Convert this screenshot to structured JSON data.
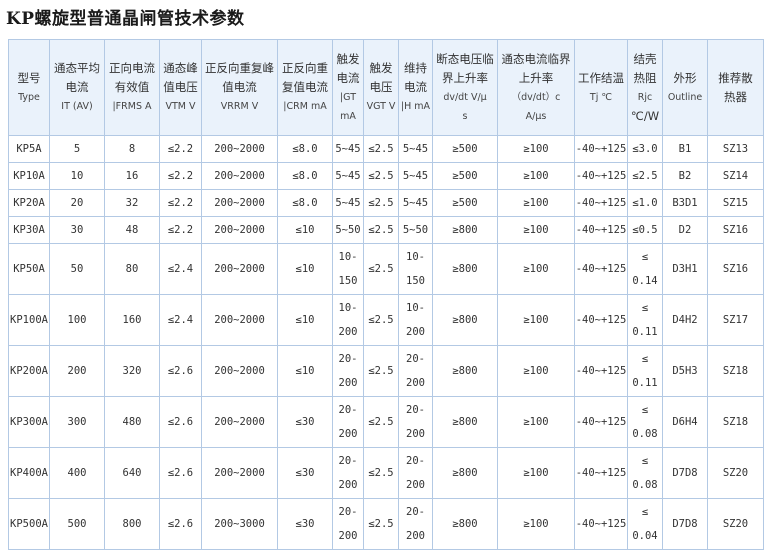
{
  "title": "KP螺旋型普通晶闸管技术参数",
  "headers": [
    [
      "型号",
      "Type"
    ],
    [
      "通态平均",
      "电流",
      "IT (AV)"
    ],
    [
      "正向电流",
      "有效值",
      "|FRMS A"
    ],
    [
      "通态峰",
      "值电压",
      "VTM V"
    ],
    [
      "正反向重复峰",
      "值电流",
      "VRRM V"
    ],
    [
      "正反向重",
      "复值电流",
      "|CRM mA"
    ],
    [
      "触发",
      "电流",
      "|GT",
      "mA"
    ],
    [
      "触发",
      "电压",
      "VGT V"
    ],
    [
      "维持",
      "电流",
      "|H mA"
    ],
    [
      "断态电压临",
      "界上升率",
      "dv/dt V/μ",
      "s"
    ],
    [
      "通态电流临界",
      "上升率",
      "（dv/dt）c",
      "A/μs"
    ],
    [
      "工作结温",
      "Tj ℃"
    ],
    [
      "结壳",
      "热阻",
      "Rjc",
      "℃/W"
    ],
    [
      "外形",
      "Outline"
    ],
    [
      "推荐散",
      "热器"
    ]
  ],
  "rows": [
    {
      "type": "KP5A",
      "it": "5",
      "ifrms": "8",
      "vtm": "≤2.2",
      "vrrm": "200~2000",
      "irrm": "≤8.0",
      "igt": [
        "5~45"
      ],
      "vgt": "≤2.5",
      "ih": [
        "5~45"
      ],
      "dvdt": "≥500",
      "didt": "≥100",
      "tj": "-40~+125",
      "rjc": [
        "≤3.0"
      ],
      "outline": "B1",
      "sink": "SZ13"
    },
    {
      "type": "KP10A",
      "it": "10",
      "ifrms": "16",
      "vtm": "≤2.2",
      "vrrm": "200~2000",
      "irrm": "≤8.0",
      "igt": [
        "5~45"
      ],
      "vgt": "≤2.5",
      "ih": [
        "5~45"
      ],
      "dvdt": "≥500",
      "didt": "≥100",
      "tj": "-40~+125",
      "rjc": [
        "≤2.5"
      ],
      "outline": "B2",
      "sink": "SZ14"
    },
    {
      "type": "KP20A",
      "it": "20",
      "ifrms": "32",
      "vtm": "≤2.2",
      "vrrm": "200~2000",
      "irrm": "≤8.0",
      "igt": [
        "5~45"
      ],
      "vgt": "≤2.5",
      "ih": [
        "5~45"
      ],
      "dvdt": "≥500",
      "didt": "≥100",
      "tj": "-40~+125",
      "rjc": [
        "≤1.0"
      ],
      "outline": "B3D1",
      "sink": "SZ15"
    },
    {
      "type": "KP30A",
      "it": "30",
      "ifrms": "48",
      "vtm": "≤2.2",
      "vrrm": "200~2000",
      "irrm": "≤10",
      "igt": [
        "5~50"
      ],
      "vgt": "≤2.5",
      "ih": [
        "5~50"
      ],
      "dvdt": "≥800",
      "didt": "≥100",
      "tj": "-40~+125",
      "rjc": [
        "≤0.5"
      ],
      "outline": "D2",
      "sink": "SZ16"
    },
    {
      "type": "KP50A",
      "it": "50",
      "ifrms": "80",
      "vtm": "≤2.4",
      "vrrm": "200~2000",
      "irrm": "≤10",
      "igt": [
        "10-",
        "150"
      ],
      "vgt": "≤2.5",
      "ih": [
        "10-",
        "150"
      ],
      "dvdt": "≥800",
      "didt": "≥100",
      "tj": "-40~+125",
      "rjc": [
        "≤",
        "0.14"
      ],
      "outline": "D3H1",
      "sink": "SZ16"
    },
    {
      "type": "KP100A",
      "it": "100",
      "ifrms": "160",
      "vtm": "≤2.4",
      "vrrm": "200~2000",
      "irrm": "≤10",
      "igt": [
        "10-",
        "200"
      ],
      "vgt": "≤2.5",
      "ih": [
        "10-",
        "200"
      ],
      "dvdt": "≥800",
      "didt": "≥100",
      "tj": "-40~+125",
      "rjc": [
        "≤",
        "0.11"
      ],
      "outline": "D4H2",
      "sink": "SZ17"
    },
    {
      "type": "KP200A",
      "it": "200",
      "ifrms": "320",
      "vtm": "≤2.6",
      "vrrm": "200~2000",
      "irrm": "≤10",
      "igt": [
        "20-",
        "200"
      ],
      "vgt": "≤2.5",
      "ih": [
        "20-",
        "200"
      ],
      "dvdt": "≥800",
      "didt": "≥100",
      "tj": "-40~+125",
      "rjc": [
        "≤",
        "0.11"
      ],
      "outline": "D5H3",
      "sink": "SZ18"
    },
    {
      "type": "KP300A",
      "it": "300",
      "ifrms": "480",
      "vtm": "≤2.6",
      "vrrm": "200~2000",
      "irrm": "≤30",
      "igt": [
        "20-",
        "200"
      ],
      "vgt": "≤2.5",
      "ih": [
        "20-",
        "200"
      ],
      "dvdt": "≥800",
      "didt": "≥100",
      "tj": "-40~+125",
      "rjc": [
        "≤",
        "0.08"
      ],
      "outline": "D6H4",
      "sink": "SZ18"
    },
    {
      "type": "KP400A",
      "it": "400",
      "ifrms": "640",
      "vtm": "≤2.6",
      "vrrm": "200~2000",
      "irrm": "≤30",
      "igt": [
        "20-",
        "200"
      ],
      "vgt": "≤2.5",
      "ih": [
        "20-",
        "200"
      ],
      "dvdt": "≥800",
      "didt": "≥100",
      "tj": "-40~+125",
      "rjc": [
        "≤",
        "0.08"
      ],
      "outline": "D7D8",
      "sink": "SZ20"
    },
    {
      "type": "KP500A",
      "it": "500",
      "ifrms": "800",
      "vtm": "≤2.6",
      "vrrm": "200~3000",
      "irrm": "≤30",
      "igt": [
        "20-",
        "200"
      ],
      "vgt": "≤2.5",
      "ih": [
        "20-",
        "200"
      ],
      "dvdt": "≥800",
      "didt": "≥100",
      "tj": "-40~+125",
      "rjc": [
        "≤",
        "0.04"
      ],
      "outline": "D7D8",
      "sink": "SZ20"
    }
  ]
}
